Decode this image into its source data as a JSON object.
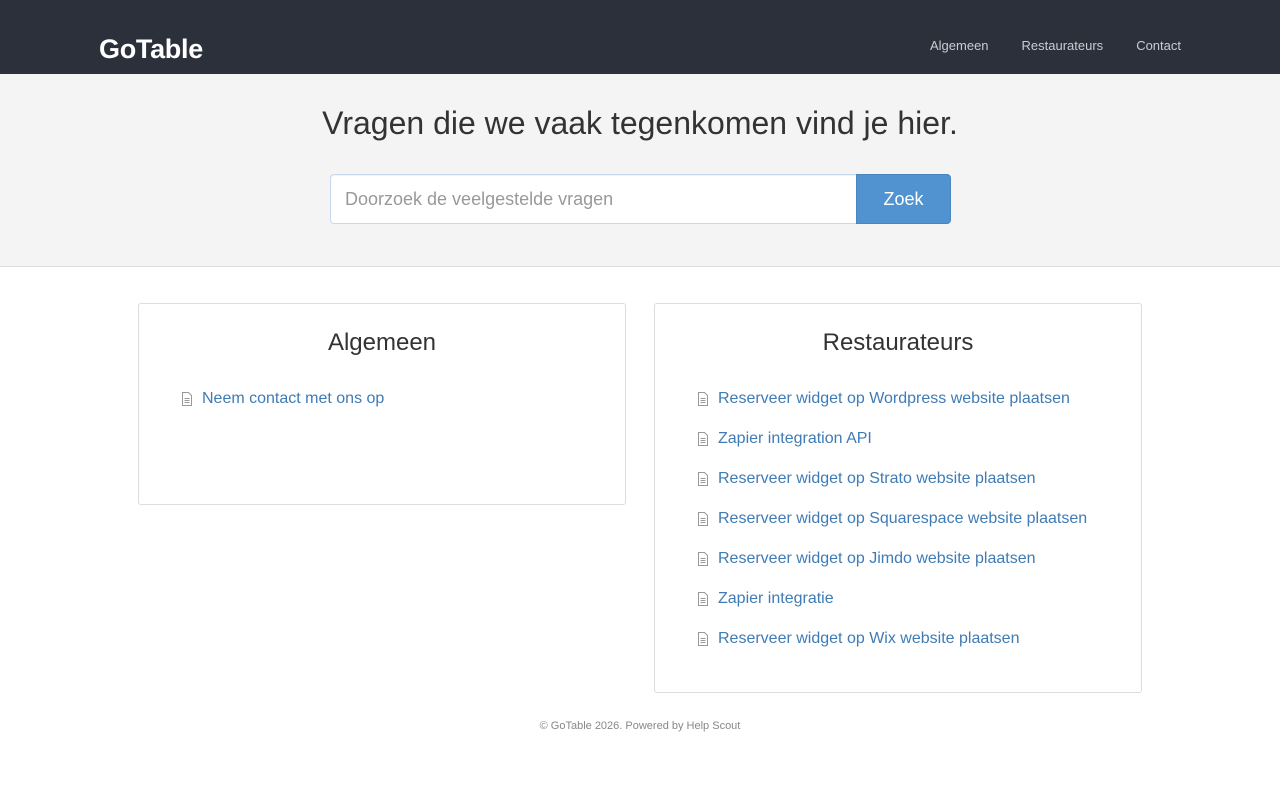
{
  "header": {
    "logo": "GoTable",
    "nav": [
      {
        "label": "Algemeen"
      },
      {
        "label": "Restaurateurs"
      },
      {
        "label": "Contact"
      }
    ]
  },
  "hero": {
    "title": "Vragen die we vaak tegenkomen vind je hier.",
    "search_placeholder": "Doorzoek de veelgestelde vragen",
    "search_value": "",
    "search_button": "Zoek"
  },
  "categories": [
    {
      "title": "Algemeen",
      "articles": [
        {
          "label": "Neem contact met ons op",
          "icon": "document-icon"
        }
      ]
    },
    {
      "title": "Restaurateurs",
      "articles": [
        {
          "label": "Reserveer widget op Wordpress website plaatsen",
          "icon": "document-icon"
        },
        {
          "label": "Zapier integration API",
          "icon": "document-icon"
        },
        {
          "label": "Reserveer widget op Strato website plaatsen",
          "icon": "document-icon"
        },
        {
          "label": "Reserveer widget op Squarespace website plaatsen",
          "icon": "document-icon"
        },
        {
          "label": "Reserveer widget op Jimdo website plaatsen",
          "icon": "document-icon"
        },
        {
          "label": "Zapier integratie",
          "icon": "document-icon"
        },
        {
          "label": "Reserveer widget op Wix website plaatsen",
          "icon": "document-icon"
        }
      ]
    }
  ],
  "footer": {
    "copyright": "© GoTable 2026. Powered by ",
    "powered_link": "Help Scout"
  },
  "colors": {
    "header_bg": "#2b303a",
    "hero_bg": "#f4f4f4",
    "accent": "#5093d0",
    "link": "#3f7bb5"
  }
}
